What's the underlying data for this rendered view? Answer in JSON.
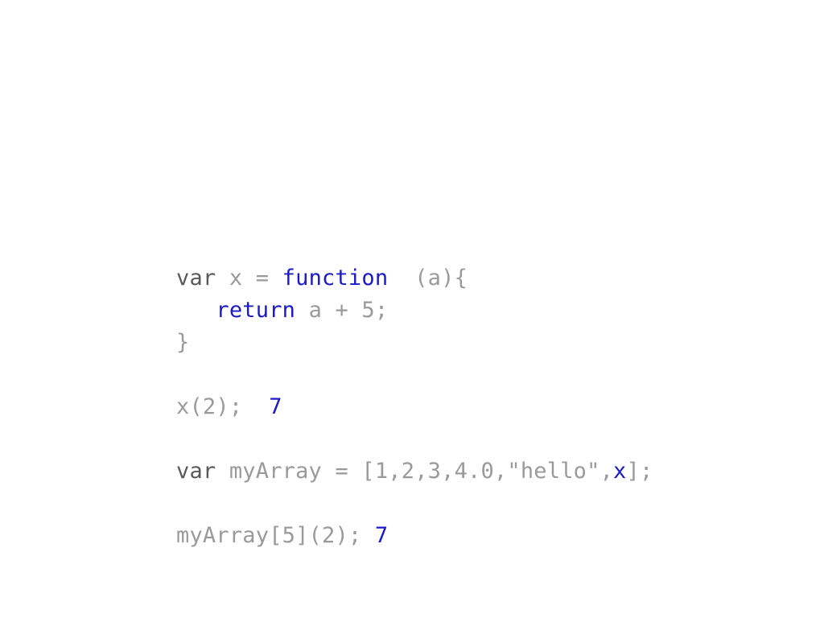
{
  "slide": {
    "background_color": "#ffffff",
    "language": "javascript",
    "colors": {
      "keyword_dark": "#5a5a5a",
      "plain_code": "#9a9a9a",
      "keyword_blue": "#1a1ac8",
      "value_blue": "#1a1ac8"
    },
    "lines": [
      {
        "id": "fn-decl",
        "tokens": [
          {
            "text": "var ",
            "style": "kw-dark"
          },
          {
            "text": "x = ",
            "style": "plain"
          },
          {
            "text": "function",
            "style": "kw-blue"
          },
          {
            "text": "  (a){",
            "style": "plain"
          }
        ]
      },
      {
        "id": "fn-return",
        "tokens": [
          {
            "text": "   ",
            "style": "plain"
          },
          {
            "text": "return",
            "style": "kw-blue"
          },
          {
            "text": " a + 5;",
            "style": "plain"
          }
        ]
      },
      {
        "id": "fn-close",
        "tokens": [
          {
            "text": "}",
            "style": "plain"
          }
        ]
      },
      {
        "id": "spacer-1",
        "blank": true,
        "tokens": []
      },
      {
        "id": "call-x",
        "tokens": [
          {
            "text": "x(2);",
            "style": "plain"
          },
          {
            "text": "  ",
            "style": "plain"
          },
          {
            "text": "7",
            "style": "value-blue"
          }
        ]
      },
      {
        "id": "spacer-2",
        "blank": true,
        "tokens": []
      },
      {
        "id": "array-decl",
        "tokens": [
          {
            "text": "var ",
            "style": "kw-dark"
          },
          {
            "text": "myArray = [1,2,3,4.0,\"hello\",",
            "style": "plain"
          },
          {
            "text": "x",
            "style": "value-blue"
          },
          {
            "text": "];",
            "style": "plain"
          }
        ]
      },
      {
        "id": "spacer-3",
        "blank": true,
        "tokens": []
      },
      {
        "id": "array-call",
        "tokens": [
          {
            "text": "myArray[5](2);",
            "style": "plain"
          },
          {
            "text": " ",
            "style": "plain"
          },
          {
            "text": "7",
            "style": "value-blue"
          }
        ]
      }
    ]
  }
}
